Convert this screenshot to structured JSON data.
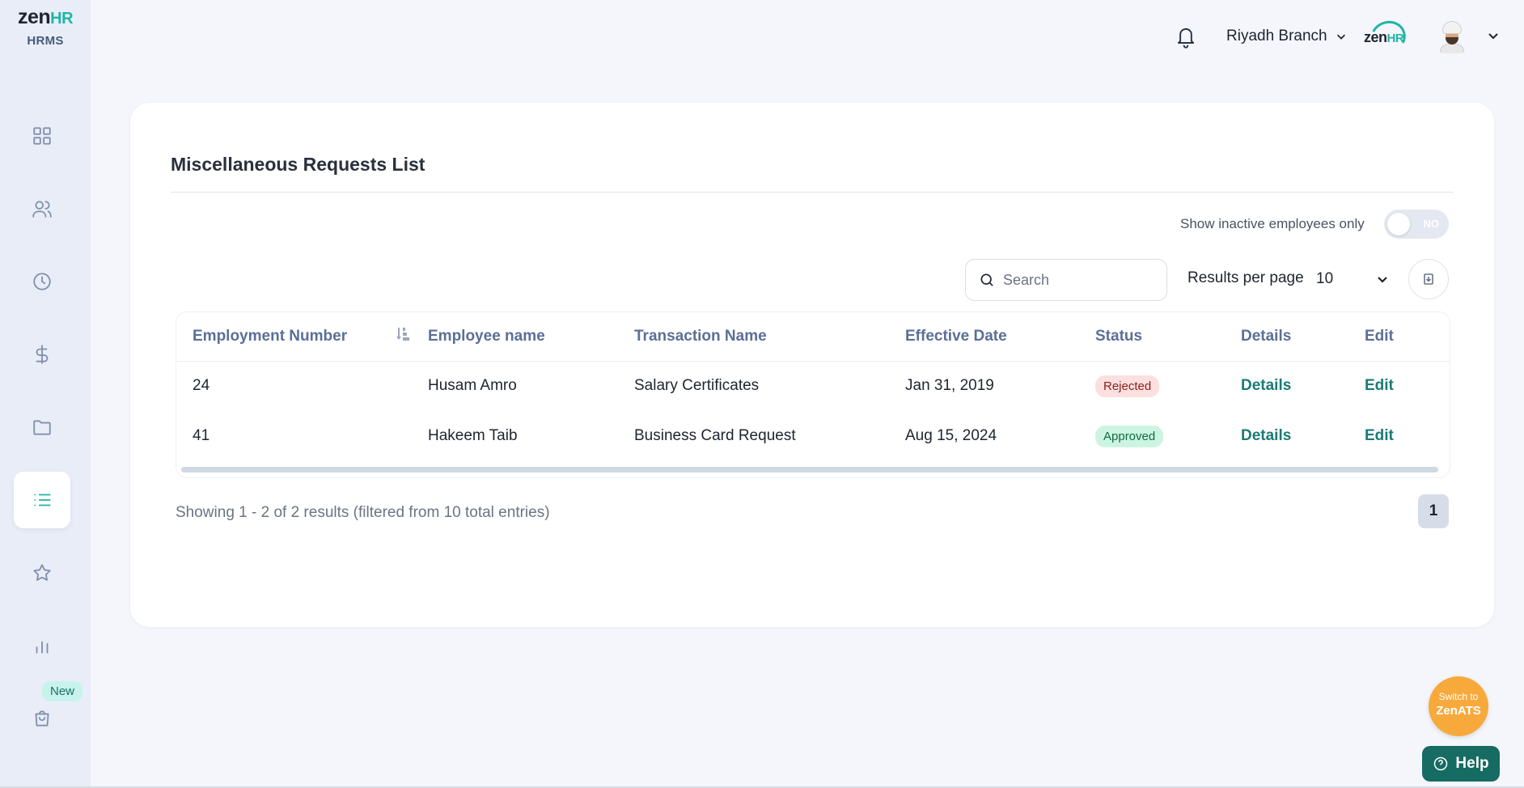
{
  "brand": {
    "logo_zen": "zen",
    "logo_hr": "HR",
    "product": "HRMS"
  },
  "sidebar": {
    "items": [
      {
        "name": "dashboard",
        "icon": "grid-icon",
        "active": false
      },
      {
        "name": "employees",
        "icon": "users-icon",
        "active": false
      },
      {
        "name": "attendance",
        "icon": "clock-icon",
        "active": false
      },
      {
        "name": "payroll",
        "icon": "dollar-icon",
        "active": false
      },
      {
        "name": "documents",
        "icon": "folder-icon",
        "active": false
      },
      {
        "name": "requests",
        "icon": "list-icon",
        "active": true
      },
      {
        "name": "performance",
        "icon": "star-icon",
        "active": false
      },
      {
        "name": "reports",
        "icon": "bar-chart-icon",
        "active": false
      },
      {
        "name": "marketplace",
        "icon": "shopping-bag-icon",
        "active": false
      }
    ],
    "new_badge": "New"
  },
  "header": {
    "branch": "Riyadh Branch",
    "company_logo_zen": "zen",
    "company_logo_hr": "HR"
  },
  "main": {
    "title": "Miscellaneous Requests List",
    "inactive_toggle": {
      "label": "Show inactive employees only",
      "state": "NO"
    },
    "search": {
      "placeholder": "Search",
      "value": ""
    },
    "results_per_page": {
      "label": "Results per page",
      "value": "10"
    },
    "table": {
      "columns": [
        "Employment Number",
        "Employee name",
        "Transaction Name",
        "Effective Date",
        "Status",
        "Details",
        "Edit"
      ],
      "rows": [
        {
          "number": "24",
          "employee": "Husam Amro",
          "transaction": "Salary Certificates",
          "date": "Jan 31, 2019",
          "status": "Rejected",
          "details": "Details",
          "edit": "Edit"
        },
        {
          "number": "41",
          "employee": "Hakeem Taib",
          "transaction": "Business Card Request",
          "date": "Aug 15, 2024",
          "status": "Approved",
          "details": "Details",
          "edit": "Edit"
        }
      ]
    },
    "summary": "Showing 1 - 2 of 2 results (filtered from 10 total entries)",
    "pagination": {
      "current": "1"
    }
  },
  "floating": {
    "switch_line1": "Switch to",
    "switch_line2": "ZenATS",
    "help": "Help"
  },
  "colors": {
    "accent": "#1fb5a5",
    "link": "#1a7b74",
    "header_text": "#5b6f96",
    "rejected_bg": "#fbe0df",
    "approved_bg": "#cdf4e3",
    "switch_bg": "#f8a93c",
    "help_bg": "#166b63"
  }
}
